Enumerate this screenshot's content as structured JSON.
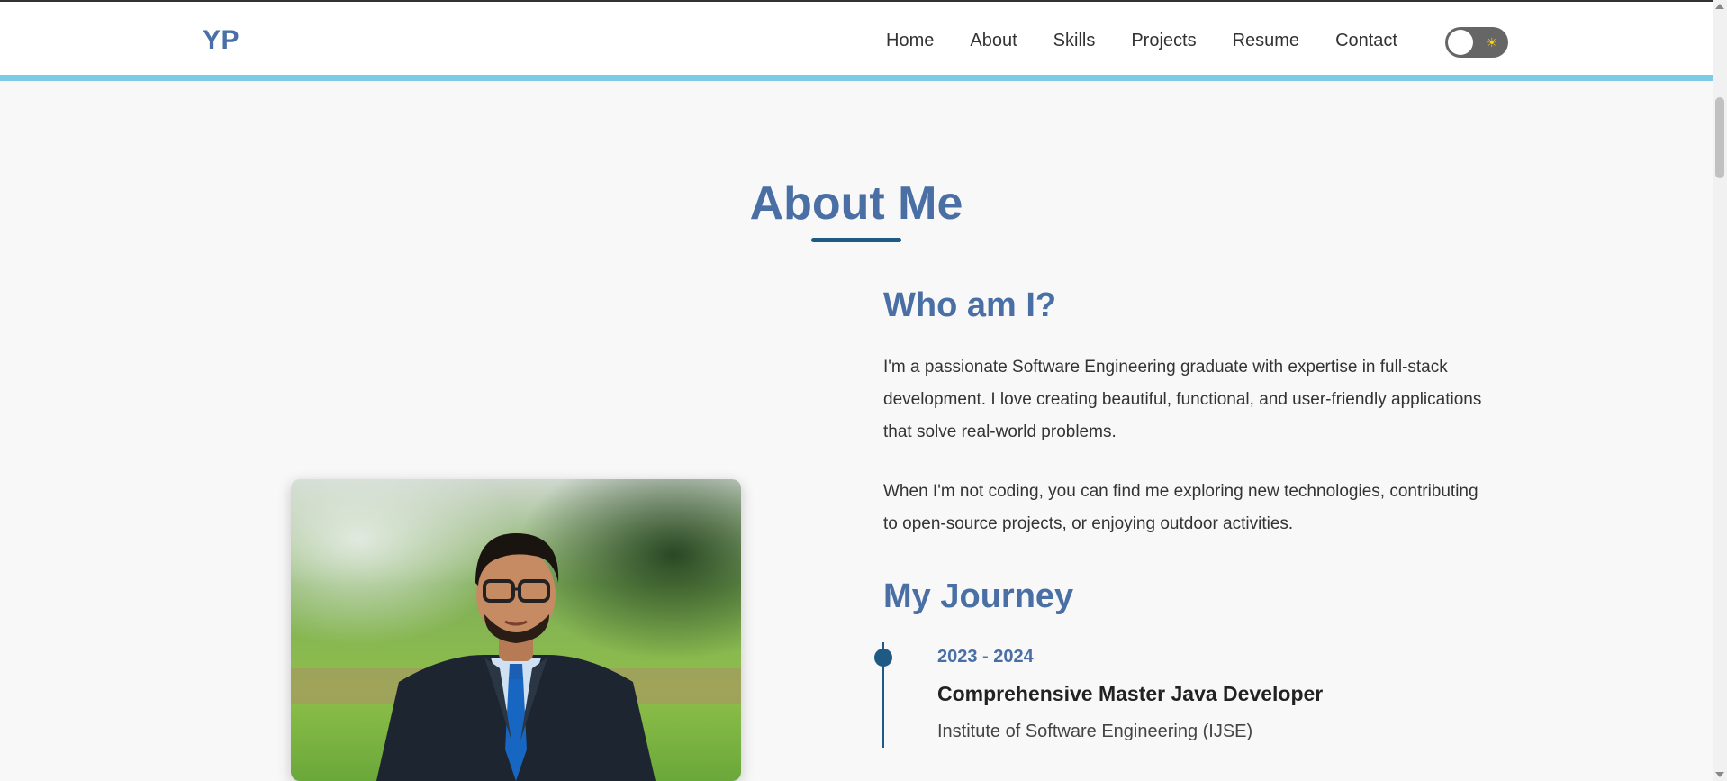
{
  "nav": {
    "logo": "YP",
    "links": [
      "Home",
      "About",
      "Skills",
      "Projects",
      "Resume",
      "Contact"
    ],
    "theme_toggle_icon": "sun-icon",
    "theme_toggle_glyph": "☀"
  },
  "about": {
    "title": "About Me",
    "who_heading": "Who am I?",
    "paragraph1": "I'm a passionate Software Engineering graduate with expertise in full-stack development. I love creating beautiful, functional, and user-friendly applications that solve real-world problems.",
    "paragraph2": "When I'm not coding, you can find me exploring new technologies, contributing to open-source projects, or enjoying outdoor activities.",
    "journey_heading": "My Journey",
    "timeline": [
      {
        "date": "2023 - 2024",
        "title": "Comprehensive Master Java Developer",
        "institution": "Institute of Software Engineering (IJSE)"
      }
    ]
  },
  "colors": {
    "accent": "#4a6fa5",
    "dark_accent": "#1f5a85",
    "nav_border": "#7ecbe6",
    "background": "#f8f8f8"
  }
}
